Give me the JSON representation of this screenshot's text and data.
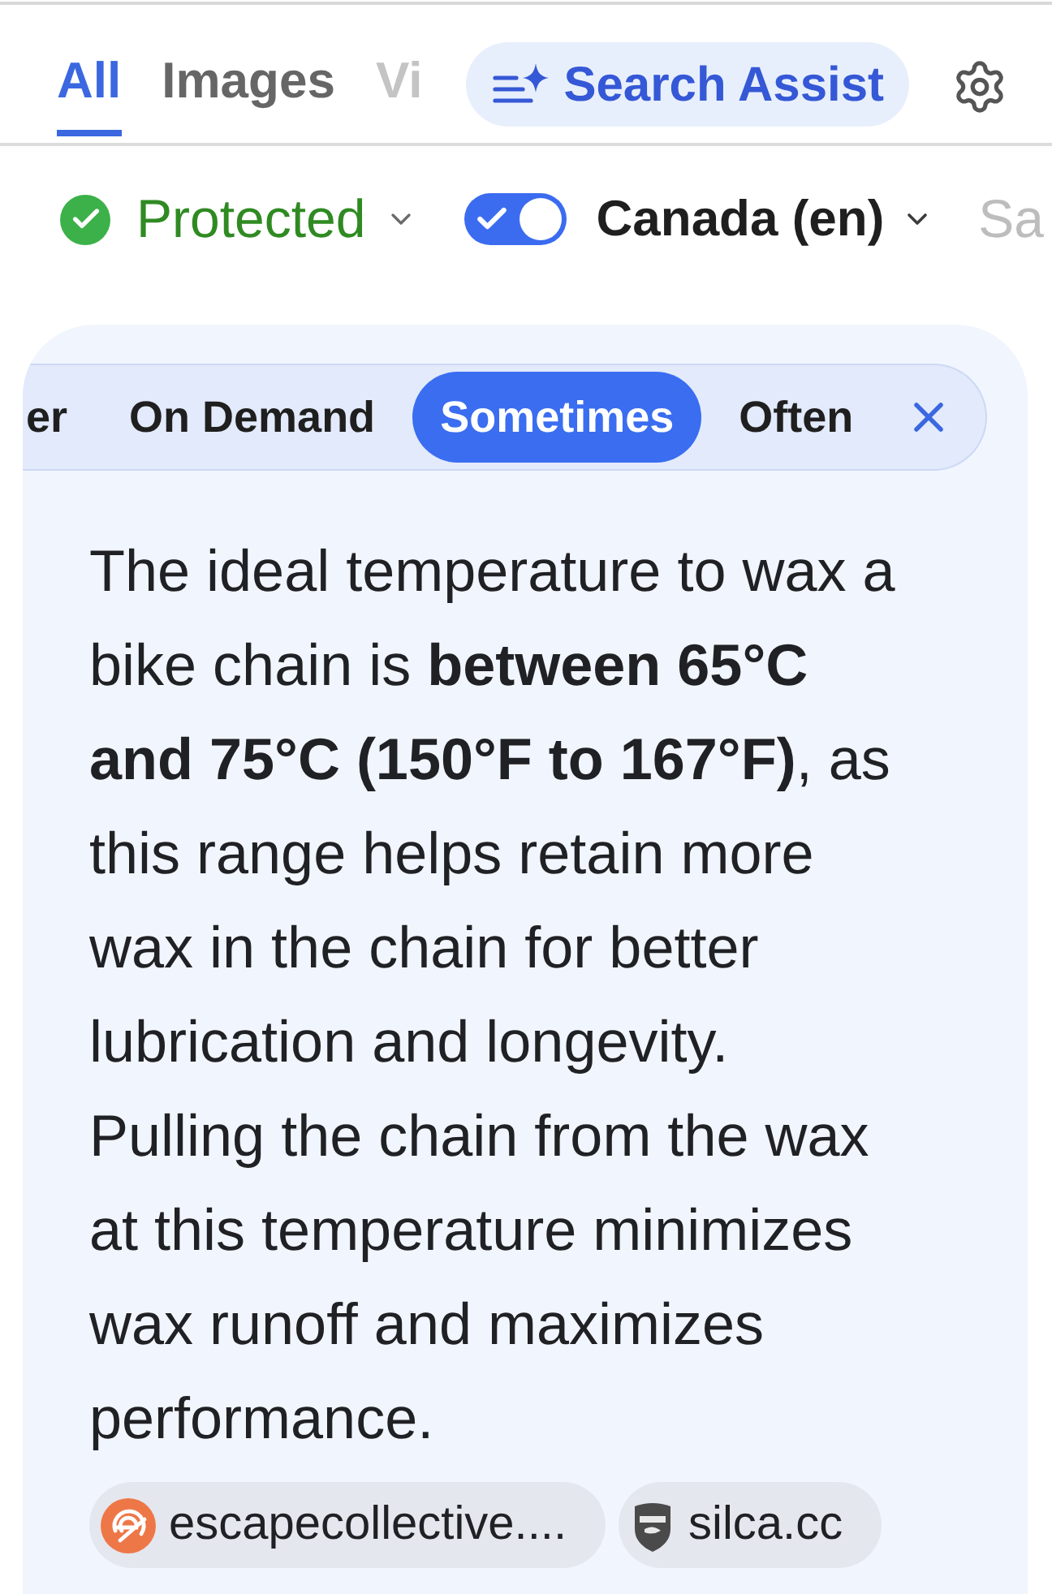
{
  "tabs": [
    {
      "label": "All",
      "selected": true,
      "faded": false
    },
    {
      "label": "Images",
      "selected": false,
      "faded": false
    },
    {
      "label": "Vi",
      "selected": false,
      "faded": true
    }
  ],
  "assist_button": {
    "label": "Search Assist"
  },
  "filters": [
    {
      "kind": "status",
      "label": "Protected",
      "on": true
    },
    {
      "kind": "toggle",
      "label": "Canada (en)",
      "on": true
    },
    {
      "kind": "faded",
      "label": "Sa"
    }
  ],
  "answer": {
    "frequency_options": [
      {
        "label": "er",
        "selected": false
      },
      {
        "label": "On Demand",
        "selected": false
      },
      {
        "label": "Sometimes",
        "selected": true
      },
      {
        "label": "Often",
        "selected": false
      }
    ],
    "text": "The ideal temperature to wax a bike chain is **between 65°C and 75°C (150°F to 167°F)**, as this range helps retain more wax in the chain for better lubrication and longevity. Pulling the chain from the wax at this temperature minimizes wax runoff and maximizes performance.",
    "sources": [
      {
        "kind": "circle_logo",
        "label": "escapecollective...."
      },
      {
        "kind": "shield_logo",
        "label": "silca.cc"
      }
    ]
  }
}
